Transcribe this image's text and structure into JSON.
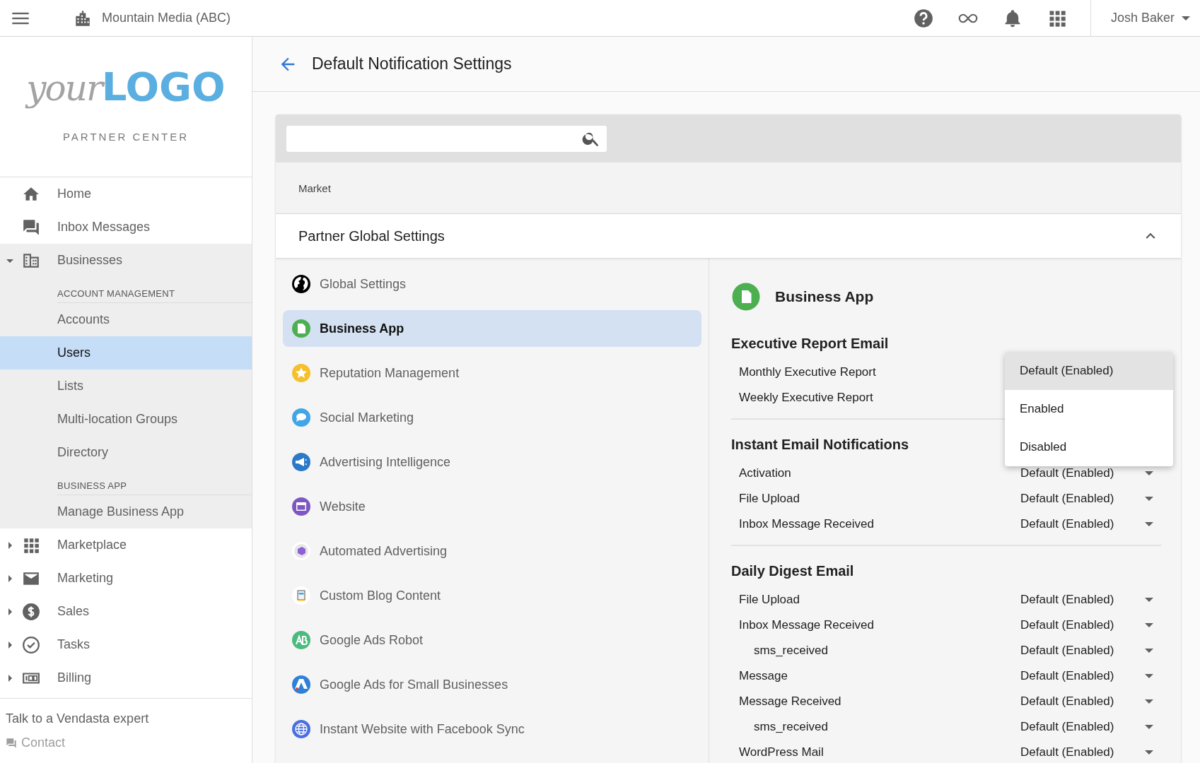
{
  "top_bar": {
    "account": "Mountain Media (ABC)",
    "user": "Josh Baker"
  },
  "logo": {
    "word_1": "your",
    "word_2": "LOGO",
    "subtitle": "PARTNER CENTER"
  },
  "sidebar": {
    "items": [
      {
        "label": "Home",
        "selected": false
      },
      {
        "label": "Inbox Messages",
        "selected": false
      },
      {
        "label": "Businesses",
        "selected": false,
        "expanded": true,
        "sections": [
          {
            "heading": "ACCOUNT MANAGEMENT",
            "items": [
              {
                "label": "Accounts",
                "selected": false
              },
              {
                "label": "Users",
                "selected": true
              },
              {
                "label": "Lists",
                "selected": false
              },
              {
                "label": "Multi-location Groups",
                "selected": false
              },
              {
                "label": "Directory",
                "selected": false
              }
            ]
          },
          {
            "heading": "BUSINESS APP",
            "items": [
              {
                "label": "Manage Business App",
                "selected": false
              }
            ]
          }
        ]
      },
      {
        "label": "Marketplace",
        "selected": false,
        "expanded": false
      },
      {
        "label": "Marketing",
        "selected": false,
        "expanded": false
      },
      {
        "label": "Sales",
        "selected": false,
        "expanded": false
      },
      {
        "label": "Tasks",
        "selected": false,
        "expanded": false
      },
      {
        "label": "Billing",
        "selected": false,
        "expanded": false
      }
    ],
    "footer": {
      "text": "Talk to a Vendasta expert",
      "link": "Contact"
    }
  },
  "page": {
    "title": "Default Notification Settings"
  },
  "filter": {
    "label": "Market"
  },
  "section": {
    "title": "Partner Global Settings",
    "expanded": true
  },
  "products": [
    {
      "label": "Global Settings",
      "selected": false
    },
    {
      "label": "Business App",
      "selected": true
    },
    {
      "label": "Reputation Management",
      "selected": false
    },
    {
      "label": "Social Marketing",
      "selected": false
    },
    {
      "label": "Advertising Intelligence",
      "selected": false
    },
    {
      "label": "Website",
      "selected": false
    },
    {
      "label": "Automated Advertising",
      "selected": false
    },
    {
      "label": "Custom Blog Content",
      "selected": false
    },
    {
      "label": "Google Ads Robot",
      "selected": false
    },
    {
      "label": "Google Ads for Small Businesses",
      "selected": false
    },
    {
      "label": "Instant Website with Facebook Sync",
      "selected": false
    }
  ],
  "detail": {
    "title": "Business App",
    "groups": [
      {
        "heading": "Executive Report Email",
        "rows": [
          {
            "label": "Monthly Executive Report"
          },
          {
            "label": "Weekly Executive Report"
          }
        ]
      },
      {
        "heading": "Instant Email Notifications",
        "rows": [
          {
            "label": "Activation",
            "value": "Default (Enabled)"
          },
          {
            "label": "File Upload",
            "value": "Default (Enabled)"
          },
          {
            "label": "Inbox Message Received",
            "value": "Default (Enabled)"
          }
        ]
      },
      {
        "heading": "Daily Digest Email",
        "rows": [
          {
            "label": "File Upload",
            "value": "Default (Enabled)"
          },
          {
            "label": "Inbox Message Received",
            "value": "Default (Enabled)",
            "children": [
              {
                "label": "sms_received",
                "value": "Default (Enabled)"
              }
            ]
          },
          {
            "label": "Message",
            "value": "Default (Enabled)"
          },
          {
            "label": "Message Received",
            "value": "Default (Enabled)",
            "children": [
              {
                "label": "sms_received",
                "value": "Default (Enabled)"
              }
            ]
          },
          {
            "label": "WordPress Mail",
            "value": "Default (Enabled)"
          }
        ]
      }
    ]
  },
  "dropdown": {
    "options": [
      {
        "label": "Default (Enabled)",
        "selected": true
      },
      {
        "label": "Enabled",
        "selected": false
      },
      {
        "label": "Disabled",
        "selected": false
      }
    ]
  }
}
